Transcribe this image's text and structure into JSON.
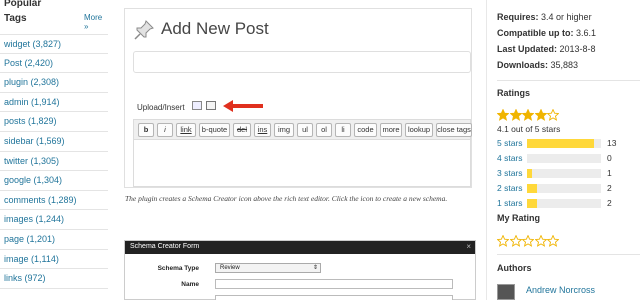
{
  "left_sidebar": {
    "popular_label": "Popular",
    "tags_heading": "Tags",
    "more_link": "More",
    "tags": [
      "widget (3,827)",
      "Post (2,420)",
      "plugin (2,308)",
      "admin (1,914)",
      "posts (1,829)",
      "sidebar (1,569)",
      "twitter (1,305)",
      "google (1,304)",
      "comments (1,289)",
      "images (1,244)",
      "page (1,201)",
      "image (1,114)",
      "links (972)"
    ]
  },
  "screenshot": {
    "title": "Add New Post",
    "upload_label": "Upload/Insert",
    "toolbar_buttons": [
      "b",
      "i",
      "link",
      "b-quote",
      "del",
      "ins",
      "img",
      "ul",
      "ol",
      "li",
      "code",
      "more",
      "lookup",
      "close tags"
    ],
    "caption": "The plugin creates a Schema Creator icon above the rich text editor. Click the icon to create a new schema."
  },
  "schema_dialog": {
    "title": "Schema Creator Form",
    "close_glyph": "×",
    "schema_type_label": "Schema Type",
    "schema_type_value": "Review",
    "name_label": "Name"
  },
  "right_sidebar": {
    "requires_label": "Requires:",
    "requires_value": "3.4 or higher",
    "compatible_label": "Compatible up to:",
    "compatible_value": "3.6.1",
    "updated_label": "Last Updated:",
    "updated_value": "2013-8-8",
    "downloads_label": "Downloads:",
    "downloads_value": "35,883",
    "ratings_heading": "Ratings",
    "rating_stars_filled": 4,
    "rating_text": "4.1 out of 5 stars",
    "rating_rows": [
      {
        "label": "5 stars",
        "count": "13",
        "fraction": 0.9
      },
      {
        "label": "4 stars",
        "count": "0",
        "fraction": 0
      },
      {
        "label": "3 stars",
        "count": "1",
        "fraction": 0.07
      },
      {
        "label": "2 stars",
        "count": "2",
        "fraction": 0.14
      },
      {
        "label": "1 stars",
        "count": "2",
        "fraction": 0.14
      }
    ],
    "my_rating_heading": "My Rating",
    "authors_heading": "Authors",
    "author_name": "Andrew Norcross",
    "star_color": "#f0b400",
    "bar_color": "#ffd83a",
    "link_color": "#21759b"
  }
}
